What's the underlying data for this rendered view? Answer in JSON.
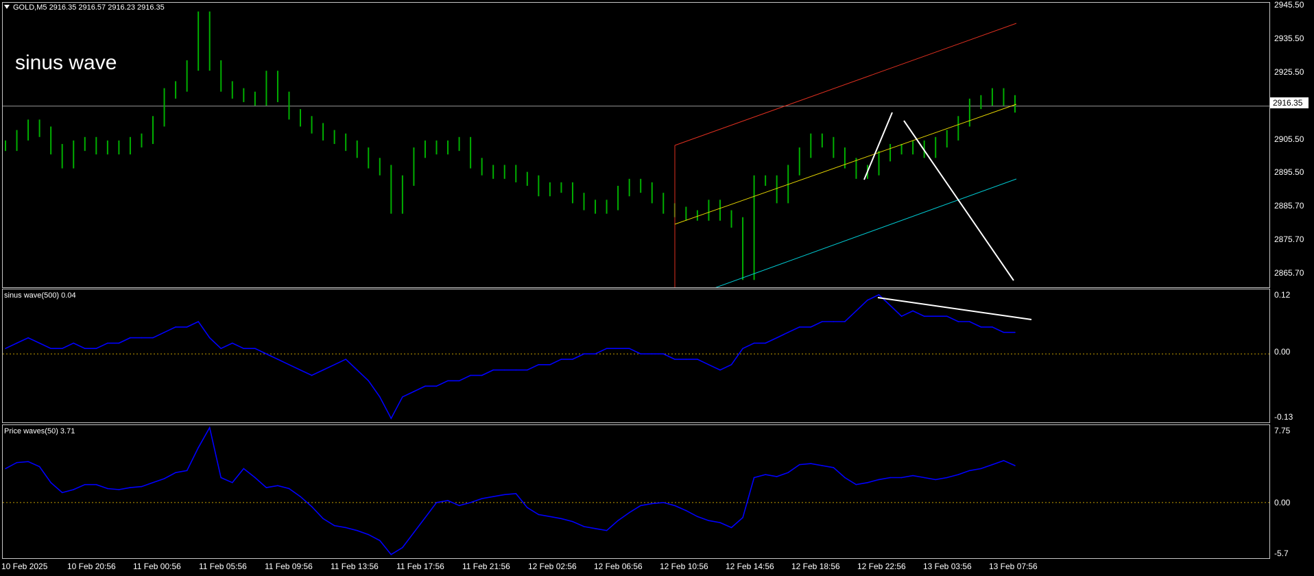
{
  "chart": {
    "symbol_line": "GOLD,M5  2916.35 2916.57 2916.23 2916.35",
    "annotation": "sinus wave",
    "current_price": "2916.35",
    "price_axis": [
      "2945.50",
      "2935.50",
      "2925.50",
      "2915.50",
      "2905.50",
      "2895.50",
      "2885.70",
      "2875.70",
      "2865.70"
    ],
    "time_axis": [
      "10 Feb 2025",
      "10 Feb 20:56",
      "11 Feb 00:56",
      "11 Feb 05:56",
      "11 Feb 09:56",
      "11 Feb 13:56",
      "11 Feb 17:56",
      "11 Feb 21:56",
      "12 Feb 02:56",
      "12 Feb 06:56",
      "12 Feb 10:56",
      "12 Feb 14:56",
      "12 Feb 18:56",
      "12 Feb 22:56",
      "13 Feb 03:56",
      "13 Feb 07:56"
    ]
  },
  "indicator1": {
    "title": "sinus wave(500) 0.04",
    "axis": [
      "0.12",
      "0.00",
      "-0.13"
    ]
  },
  "indicator2": {
    "title": "Price waves(50) 3.71",
    "axis": [
      "7.75",
      "0.00",
      "-5.7"
    ]
  },
  "colors": {
    "price_line": "#00b000",
    "indicator_line": "#0000ff",
    "zero_line": "#c8a000",
    "channel_upper": "#e03020",
    "channel_mid": "#e8d800",
    "channel_lower": "#00c8d0",
    "trendlines": "#ffffff"
  },
  "chart_data": {
    "type": "line",
    "series": [
      {
        "values": [
          2905,
          2908,
          2911,
          2909,
          2904,
          2900,
          2905,
          2906,
          2904,
          2905,
          2904,
          2906,
          2907,
          2912,
          2920,
          2922,
          2928,
          2942,
          2928,
          2922,
          2920,
          2919,
          2918,
          2925,
          2919,
          2914,
          2912,
          2910,
          2908,
          2907,
          2905,
          2903,
          2900,
          2898,
          2887,
          2895,
          2903,
          2905,
          2904,
          2905,
          2906,
          2900,
          2898,
          2897,
          2898,
          2896,
          2895,
          2892,
          2893,
          2893,
          2890,
          2888,
          2887,
          2888,
          2892,
          2894,
          2893,
          2890,
          2887,
          2886,
          2885,
          2885,
          2888,
          2885,
          2883,
          2868,
          2895,
          2895,
          2890,
          2898,
          2903,
          2907,
          2906,
          2903,
          2900,
          2897,
          2898,
          2902,
          2904,
          2904,
          2905,
          2903,
          2906,
          2908,
          2912,
          2917,
          2918,
          2920,
          2918,
          2916
        ]
      },
      {
        "values": [
          0.01,
          0.02,
          0.03,
          0.02,
          0.01,
          0.01,
          0.02,
          0.01,
          0.01,
          0.02,
          0.02,
          0.03,
          0.03,
          0.03,
          0.04,
          0.05,
          0.05,
          0.06,
          0.03,
          0.01,
          0.02,
          0.01,
          0.01,
          0.0,
          -0.01,
          -0.02,
          -0.03,
          -0.04,
          -0.03,
          -0.02,
          -0.01,
          -0.03,
          -0.05,
          -0.08,
          -0.12,
          -0.08,
          -0.07,
          -0.06,
          -0.06,
          -0.05,
          -0.05,
          -0.04,
          -0.04,
          -0.03,
          -0.03,
          -0.03,
          -0.03,
          -0.02,
          -0.02,
          -0.01,
          -0.01,
          0.0,
          0.0,
          0.01,
          0.01,
          0.01,
          0.0,
          0.0,
          0.0,
          -0.01,
          -0.01,
          -0.01,
          -0.02,
          -0.03,
          -0.02,
          0.01,
          0.02,
          0.02,
          0.03,
          0.04,
          0.05,
          0.05,
          0.06,
          0.06,
          0.06,
          0.08,
          0.1,
          0.11,
          0.09,
          0.07,
          0.08,
          0.07,
          0.07,
          0.07,
          0.06,
          0.06,
          0.05,
          0.05,
          0.04,
          0.04
        ]
      },
      {
        "values": [
          3.4,
          4.0,
          4.1,
          3.6,
          2.0,
          1.0,
          1.3,
          1.8,
          1.8,
          1.4,
          1.3,
          1.5,
          1.6,
          2.0,
          2.4,
          3.0,
          3.2,
          5.5,
          7.5,
          2.5,
          2.0,
          3.4,
          2.5,
          1.5,
          1.7,
          1.4,
          0.6,
          -0.4,
          -1.6,
          -2.3,
          -2.5,
          -2.8,
          -3.2,
          -3.8,
          -5.2,
          -4.5,
          -3.0,
          -1.5,
          0.0,
          0.2,
          -0.3,
          0.0,
          0.4,
          0.6,
          0.8,
          0.9,
          -0.5,
          -1.2,
          -1.4,
          -1.6,
          -1.9,
          -2.4,
          -2.6,
          -2.8,
          -1.8,
          -1.0,
          -0.3,
          -0.1,
          0.0,
          -0.3,
          -0.8,
          -1.4,
          -1.8,
          -2.0,
          -2.5,
          -1.5,
          2.5,
          2.8,
          2.6,
          3.0,
          3.8,
          3.9,
          3.7,
          3.5,
          2.5,
          1.8,
          2.0,
          2.3,
          2.5,
          2.5,
          2.7,
          2.5,
          2.3,
          2.5,
          2.8,
          3.2,
          3.4,
          3.8,
          4.2,
          3.7
        ]
      }
    ],
    "ylim_main": [
      2864,
      2946
    ],
    "ylim_ind1": [
      -0.13,
      0.12
    ],
    "ylim_ind2": [
      -5.7,
      7.75
    ]
  }
}
